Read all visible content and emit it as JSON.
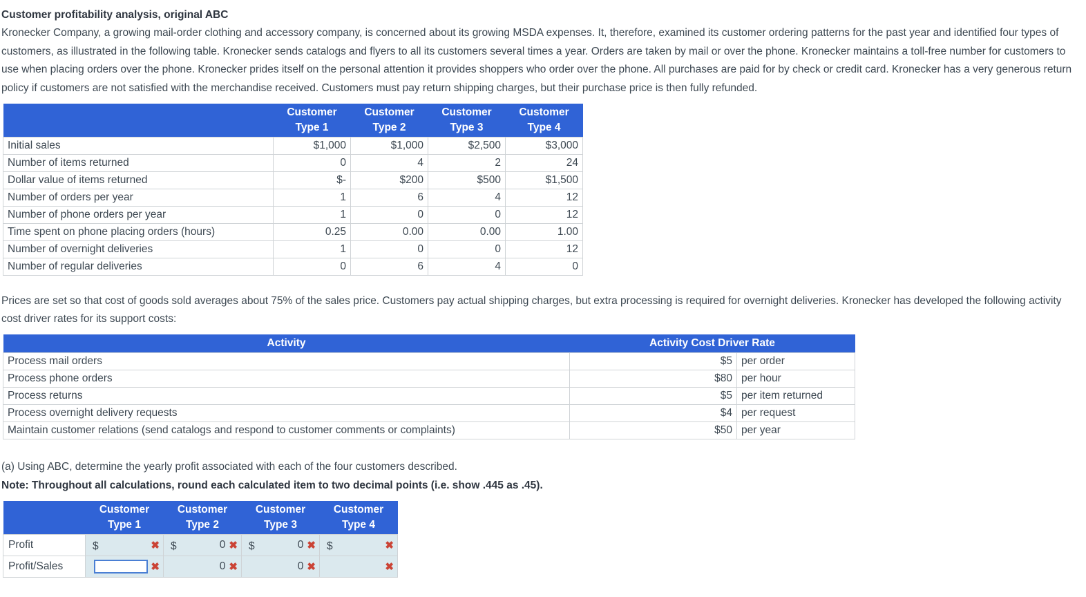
{
  "title": "Customer profitability analysis, original ABC",
  "intro_paragraph": "Kronecker Company, a growing mail-order clothing and accessory company, is concerned about its growing MSDA expenses. It, therefore, examined its customer ordering patterns for the past year and identified four types of customers, as illustrated in the following table. Kronecker sends catalogs and flyers to all its customers several times a year. Orders are taken by mail or over the phone. Kronecker maintains a toll-free number for customers to use when placing orders over the phone. Kronecker prides itself on the personal attention it provides shoppers who order over the phone. All purchases are paid for by check or credit card. Kronecker has a very generous return policy if customers are not satisfied with the merchandise received. Customers must pay return shipping charges, but their purchase price is then fully refunded.",
  "customer_table": {
    "corner_label": "",
    "headers": [
      {
        "line1": "Customer",
        "line2": "Type 1"
      },
      {
        "line1": "Customer",
        "line2": "Type 2"
      },
      {
        "line1": "Customer",
        "line2": "Type 3"
      },
      {
        "line1": "Customer",
        "line2": "Type 4"
      }
    ],
    "rows": [
      {
        "label": "Initial sales",
        "values": [
          "$1,000",
          "$1,000",
          "$2,500",
          "$3,000"
        ]
      },
      {
        "label": "Number of items returned",
        "values": [
          "0",
          "4",
          "2",
          "24"
        ]
      },
      {
        "label": "Dollar value of items returned",
        "values": [
          "$-",
          "$200",
          "$500",
          "$1,500"
        ]
      },
      {
        "label": "Number of orders per year",
        "values": [
          "1",
          "6",
          "4",
          "12"
        ]
      },
      {
        "label": "Number of phone orders per year",
        "values": [
          "1",
          "0",
          "0",
          "12"
        ]
      },
      {
        "label": "Time spent on phone placing orders (hours)",
        "values": [
          "0.25",
          "0.00",
          "0.00",
          "1.00"
        ]
      },
      {
        "label": "Number of overnight deliveries",
        "values": [
          "1",
          "0",
          "0",
          "12"
        ]
      },
      {
        "label": "Number of regular deliveries",
        "values": [
          "0",
          "6",
          "4",
          "0"
        ]
      }
    ]
  },
  "prices_paragraph": "Prices are set so that cost of goods sold averages about 75% of the sales price. Customers pay actual shipping charges, but extra processing is required for overnight deliveries. Kronecker has developed the following activity cost driver rates for its support costs:",
  "activity_table": {
    "headers": [
      "Activity",
      "Activity Cost Driver Rate"
    ],
    "rows": [
      {
        "activity": "Process mail orders",
        "rate": "$5",
        "unit": "per order"
      },
      {
        "activity": "Process phone orders",
        "rate": "$80",
        "unit": "per hour"
      },
      {
        "activity": "Process returns",
        "rate": "$5",
        "unit": "per item returned"
      },
      {
        "activity": "Process overnight delivery requests",
        "rate": "$4",
        "unit": "per request"
      },
      {
        "activity": "Maintain customer relations (send catalogs and respond to customer comments or complaints)",
        "rate": "$50",
        "unit": "per year"
      }
    ]
  },
  "question": "(a) Using ABC, determine the yearly profit associated with each of the four customers described.",
  "note": "Note: Throughout all calculations, round each calculated item to two decimal points (i.e. show .445 as .45).",
  "answer_table": {
    "corner_label": "",
    "headers": [
      {
        "line1": "Customer",
        "line2": "Type 1"
      },
      {
        "line1": "Customer",
        "line2": "Type 2"
      },
      {
        "line1": "Customer",
        "line2": "Type 3"
      },
      {
        "line1": "Customer",
        "line2": "Type 4"
      }
    ],
    "rows": [
      {
        "label": "Profit",
        "cells": [
          {
            "prefix": "$",
            "value": "",
            "input": false,
            "status": "incorrect-icon"
          },
          {
            "prefix": "$",
            "value": "0",
            "input": false,
            "status": "incorrect-icon"
          },
          {
            "prefix": "$",
            "value": "0",
            "input": false,
            "status": "incorrect-icon"
          },
          {
            "prefix": "$",
            "value": "",
            "input": false,
            "status": "incorrect-icon"
          }
        ]
      },
      {
        "label": "Profit/Sales",
        "cells": [
          {
            "prefix": "",
            "value": "",
            "input": true,
            "status": "incorrect-icon"
          },
          {
            "prefix": "",
            "value": "0",
            "input": false,
            "status": "incorrect-icon"
          },
          {
            "prefix": "",
            "value": "0",
            "input": false,
            "status": "incorrect-icon"
          },
          {
            "prefix": "",
            "value": "",
            "input": false,
            "status": "incorrect-icon"
          }
        ]
      }
    ],
    "incorrect_glyph": "✖",
    "input_value": "",
    "input_placeholder": ""
  },
  "colors": {
    "header_blue": "#3063d6",
    "answer_cell_blue": "#dbe9ee",
    "incorrect_red": "#cb4335",
    "focus_border": "#4a7fd4",
    "text": "#3d4852",
    "border_gray": "#cfd3d6"
  }
}
